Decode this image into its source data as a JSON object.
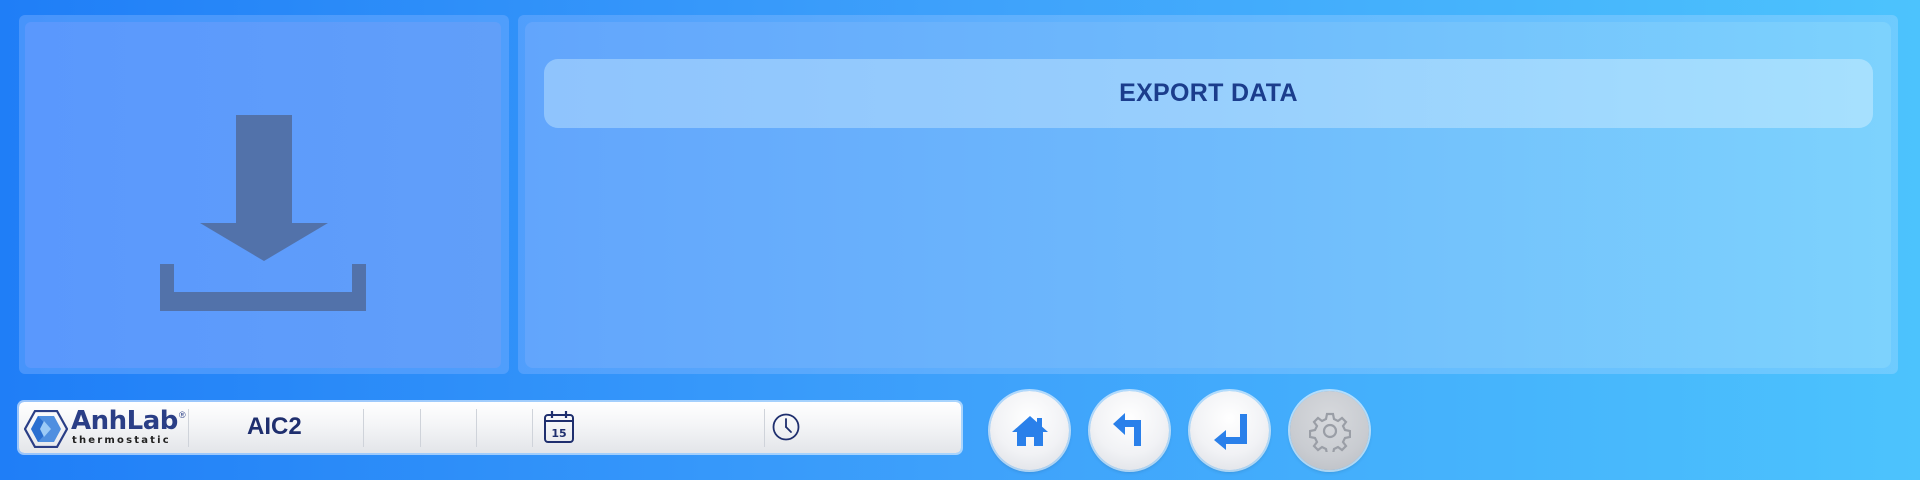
{
  "export_panel": {
    "title": "EXPORT DATA"
  },
  "icon_panel": {
    "icon": "download-icon"
  },
  "status_bar": {
    "logo_name": "AnhLab",
    "logo_registered": "®",
    "logo_subtitle": "thermostatic",
    "device_name": "AIC2",
    "date_icon": "calendar-icon",
    "calendar_day": "15",
    "date_value": "",
    "time_icon": "clock-icon",
    "time_value": ""
  },
  "nav_buttons": {
    "home_icon": "home-icon",
    "back_icon": "back-arrow-icon",
    "enter_icon": "enter-arrow-icon",
    "settings_icon": "gear-icon"
  },
  "colors": {
    "accent_blue": "#1f7ef7",
    "title_text": "#1b3d8c",
    "icon_fill": "#5272aa",
    "nav_icon_blue": "#2a80ea"
  }
}
